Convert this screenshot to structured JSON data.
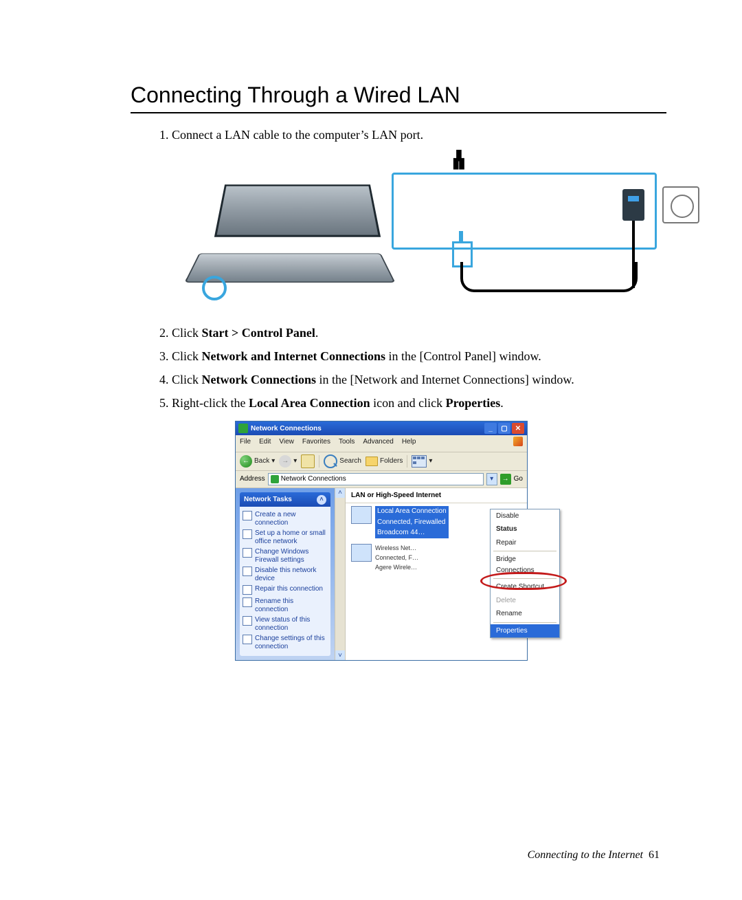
{
  "title": "Connecting Through a Wired LAN",
  "steps": {
    "1": "Connect a LAN cable to the computer’s LAN port.",
    "2_pre": "Click ",
    "2_bold": "Start > Control Panel",
    "2_post": ".",
    "3_pre": "Click ",
    "3_bold": "Network and Internet Connections",
    "3_post": " in the [Control Panel] window.",
    "4_pre": "Click ",
    "4_bold": "Network Connections",
    "4_post": " in the [Network and Internet Connections] window.",
    "5_pre": "Right-click the ",
    "5_bold1": "Local Area Connection",
    "5_mid": " icon and click ",
    "5_bold2": "Properties",
    "5_post": "."
  },
  "window": {
    "title": "Network Connections",
    "menu": [
      "File",
      "Edit",
      "View",
      "Favorites",
      "Tools",
      "Advanced",
      "Help"
    ],
    "toolbar": {
      "back": "Back",
      "search": "Search",
      "folders": "Folders"
    },
    "address_label": "Address",
    "address_value": "Network Connections",
    "go": "Go",
    "left_panel_title": "Network Tasks",
    "tasks": [
      "Create a new connection",
      "Set up a home or small office network",
      "Change Windows Firewall settings",
      "Disable this network device",
      "Repair this connection",
      "Rename this connection",
      "View status of this connection",
      "Change settings of this connection"
    ],
    "section_header": "LAN or High-Speed Internet",
    "connections": [
      {
        "name": "Local Area Connection",
        "status": "Connected, Firewalled",
        "device": "Broadcom 44…",
        "selected": true
      },
      {
        "name": "Wireless Net…",
        "status": "Connected, F…",
        "device": "Agere Wirele…",
        "selected": false
      }
    ],
    "context_menu": {
      "items": [
        "Disable",
        "Status",
        "Repair",
        "Bridge Connections",
        "Create Shortcut",
        "Delete",
        "Rename",
        "Properties"
      ],
      "disabled": [
        "Delete"
      ],
      "highlighted": "Properties"
    }
  },
  "footer": {
    "section": "Connecting to the Internet",
    "page": "61"
  }
}
